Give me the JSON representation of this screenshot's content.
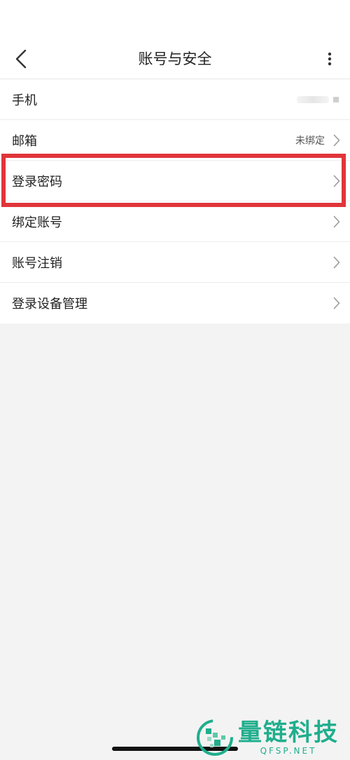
{
  "header": {
    "title": "账号与安全"
  },
  "items": [
    {
      "label": "手机",
      "value": ""
    },
    {
      "label": "邮箱",
      "value": "未绑定"
    },
    {
      "label": "登录密码",
      "value": ""
    },
    {
      "label": "绑定账号",
      "value": ""
    },
    {
      "label": "账号注销",
      "value": ""
    },
    {
      "label": "登录设备管理",
      "value": ""
    }
  ],
  "watermark": {
    "title": "量链科技",
    "subtitle": "QFSP.NET"
  },
  "colors": {
    "highlight": "#e0353a",
    "watermark": "#1fae8c",
    "background": "#f3f3f3"
  }
}
